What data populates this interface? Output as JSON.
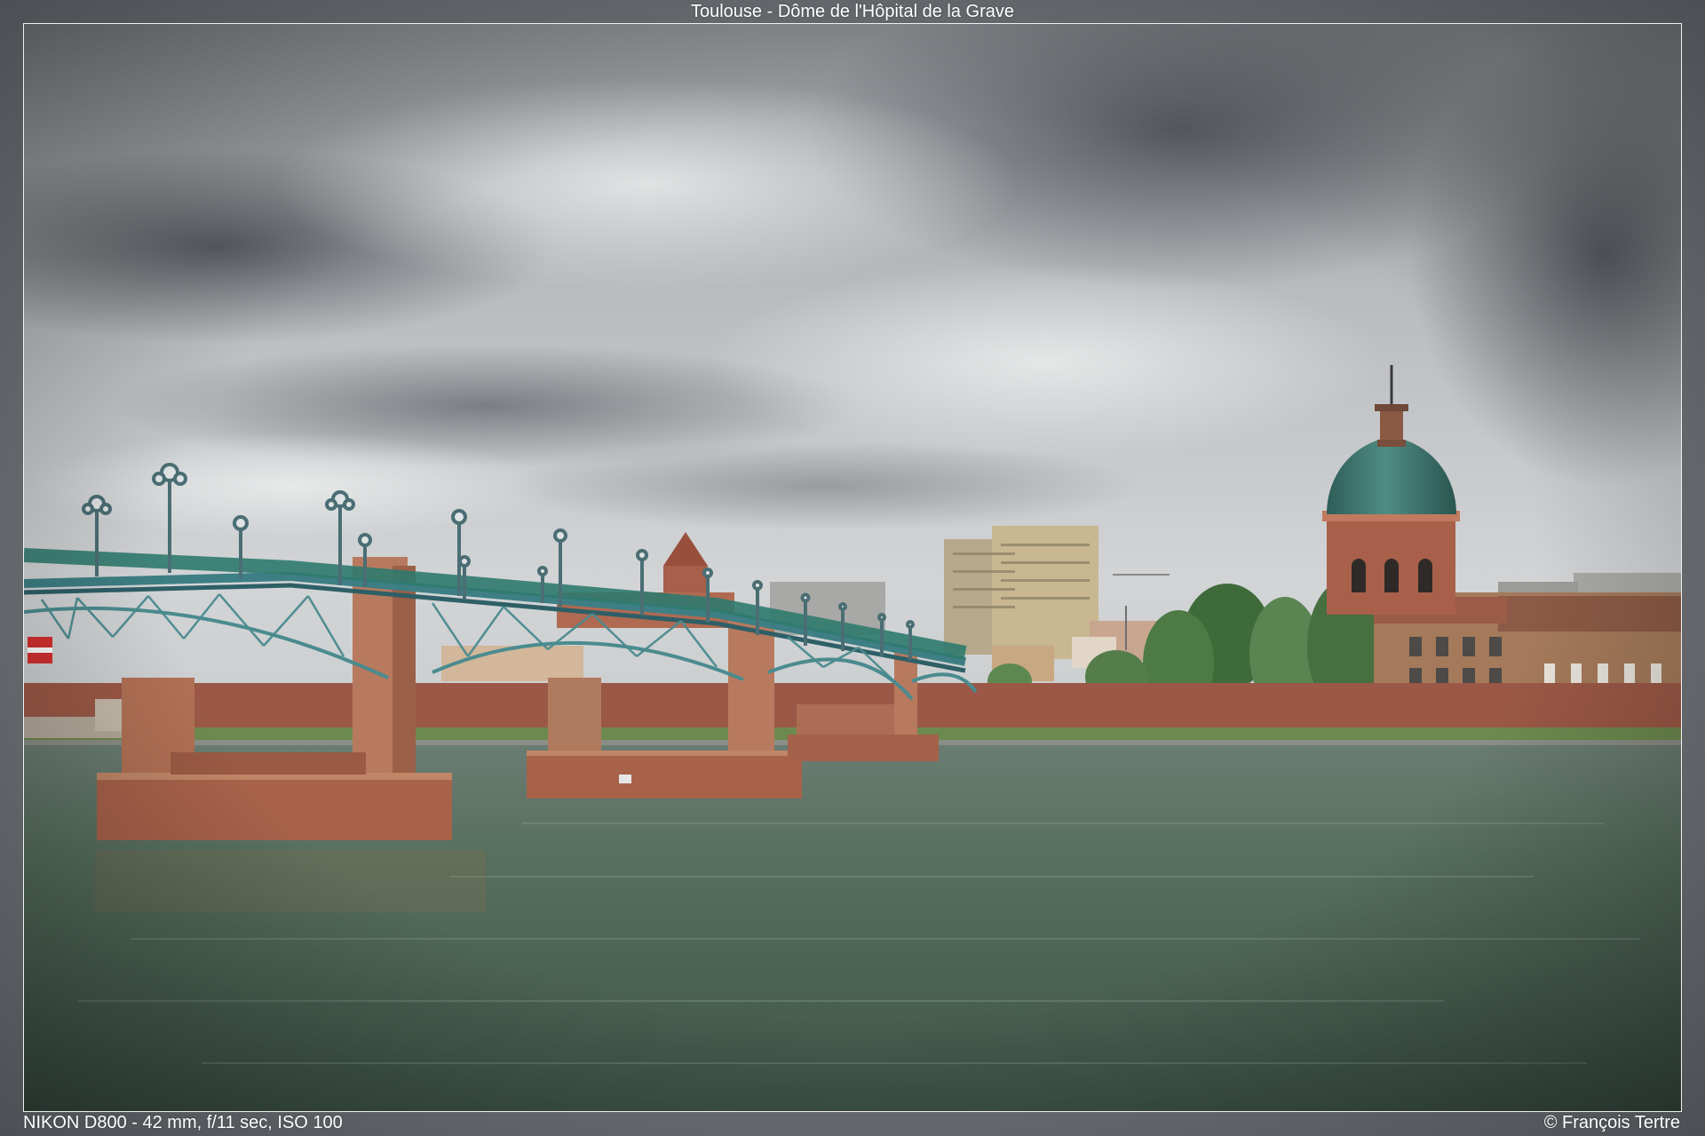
{
  "header": {
    "title": "Toulouse - Dôme de l'Hôpital de la Grave"
  },
  "footer": {
    "camera": "NIKON D800 - 42 mm, f/11 sec, ISO 100",
    "credit": "© François Tertre"
  },
  "photo": {
    "subject": "Pont Saint-Pierre over the Garonne and the dome of the Hôpital de la Grave",
    "colors": {
      "sky_light": "#d4d6d8",
      "sky_dark": "#4a4e54",
      "water": "#4f6658",
      "bridge_steel": "#3f7f86",
      "brick": "#a8604a",
      "dome_copper": "#3e7a72"
    }
  }
}
